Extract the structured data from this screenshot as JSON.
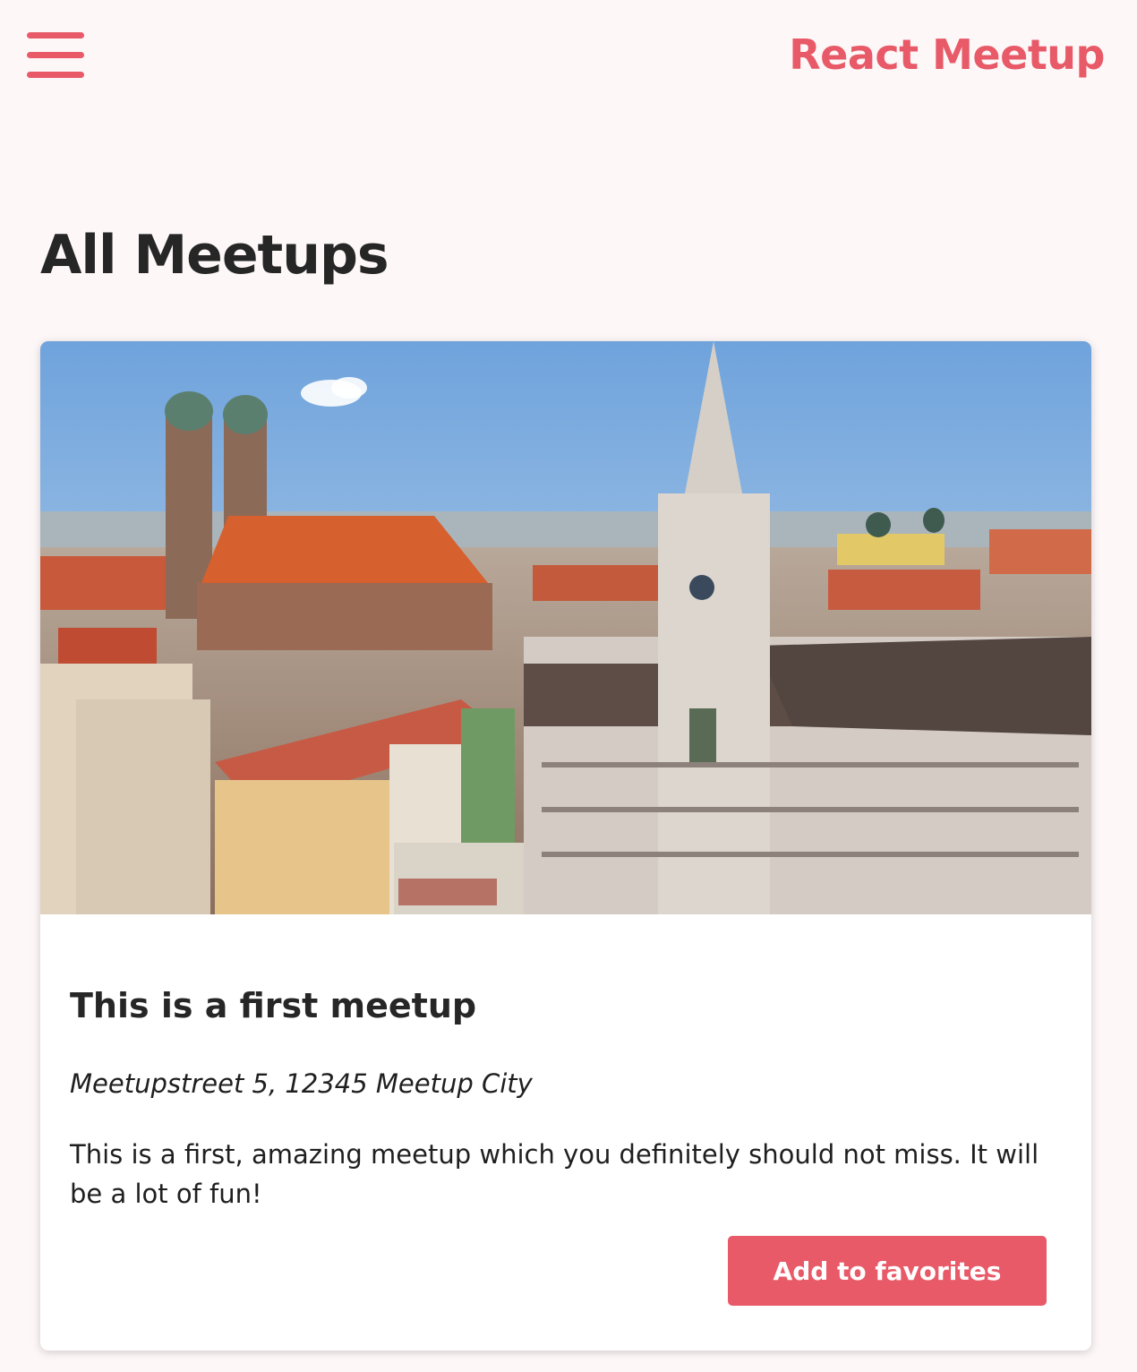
{
  "header": {
    "menu_icon": "hamburger-menu-icon",
    "logo": "React Meetup",
    "accent_color": "#e85a68"
  },
  "page": {
    "title": "All Meetups"
  },
  "meetups": [
    {
      "image": "photo of a city center with cathedral towers and gothic town hall",
      "title": "This is a first meetup",
      "address": "Meetupstreet 5, 12345 Meetup City",
      "description": "This is a first, amazing meetup which you definitely should not miss. It will be a lot of fun!",
      "button_label": "Add to favorites"
    }
  ]
}
